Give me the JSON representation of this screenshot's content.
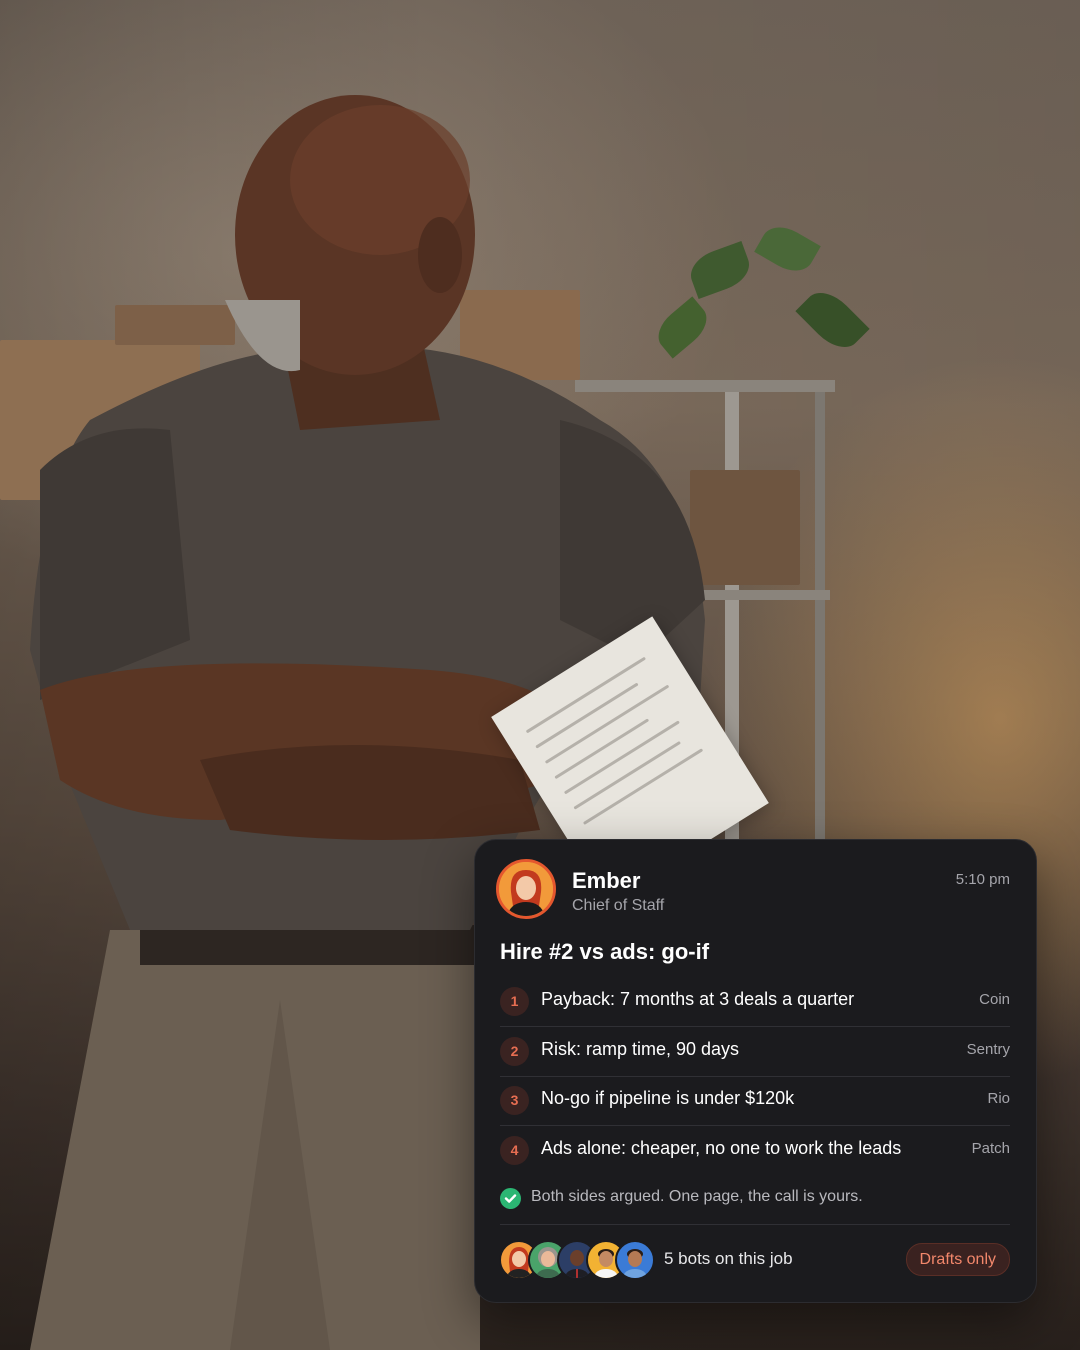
{
  "card": {
    "sender_name": "Ember",
    "sender_role": "Chief of Staff",
    "time": "5:10 pm",
    "headline": "Hire #2 vs ads: go-if",
    "items": [
      {
        "num": "1",
        "text": "Payback: 7 months at 3 deals a quarter",
        "owner": "Coin"
      },
      {
        "num": "2",
        "text": "Risk: ramp time, 90 days",
        "owner": "Sentry"
      },
      {
        "num": "3",
        "text": "No-go if pipeline is under $120k",
        "owner": "Rio"
      },
      {
        "num": "4",
        "text": "Ads alone: cheaper, no one to work the leads",
        "owner": "Patch"
      }
    ],
    "status_note": "Both sides argued. One page, the call is yours.",
    "bots_label": "5 bots on this job",
    "mode_badge": "Drafts only"
  },
  "colors": {
    "card_bg": "#1b1b1e",
    "accent": "#e76e52",
    "success": "#2bb673",
    "muted_text": "#a5a5ab"
  },
  "icons": {
    "status": "check-circle-icon"
  }
}
